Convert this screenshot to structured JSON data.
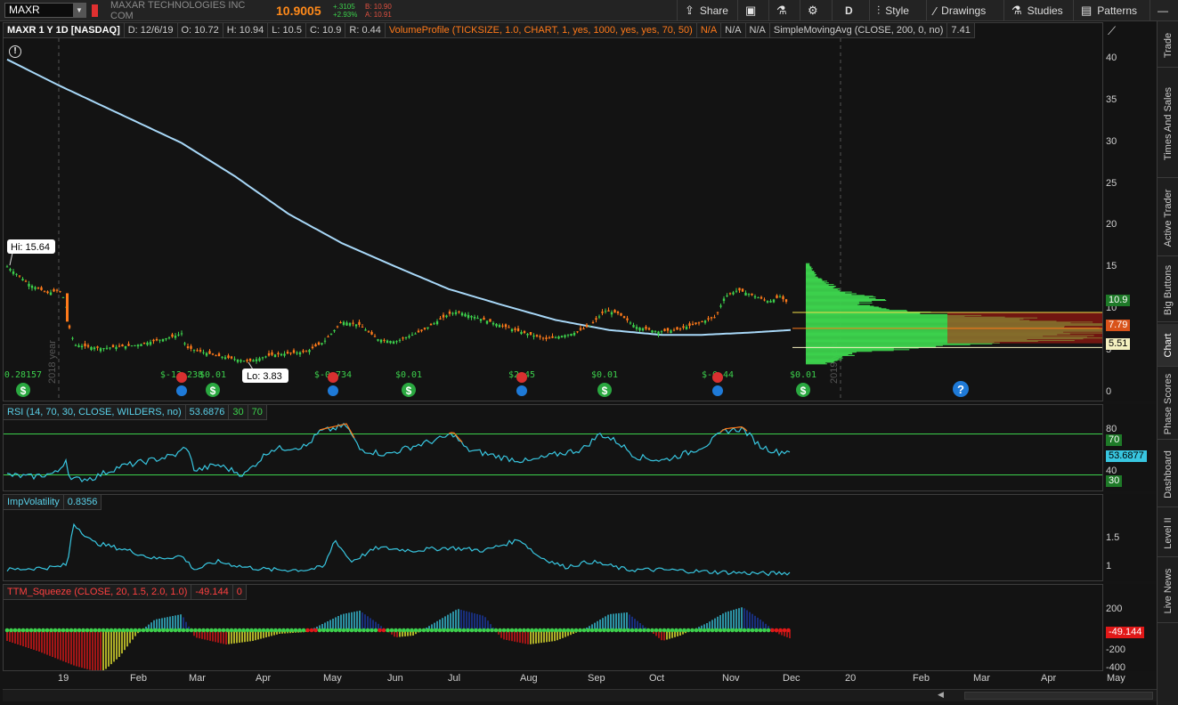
{
  "toolbar": {
    "symbol": "MAXR",
    "company": "MAXAR TECHNOLOGIES INC COM",
    "last": "10.9005",
    "change": "+.3105",
    "change_pct": "+2.93%",
    "bid": "B: 10.90",
    "ask": "A: 10.91",
    "buttons": {
      "share": "Share",
      "period": "D",
      "style": "Style",
      "drawings": "Drawings",
      "studies": "Studies",
      "patterns": "Patterns"
    }
  },
  "sidebar": {
    "tabs": [
      "Trade",
      "Times And Sales",
      "Active Trader",
      "Big Buttons",
      "Chart",
      "Phase Scores",
      "Dashboard",
      "Level II",
      "Live News"
    ],
    "active": "Chart"
  },
  "price_panel": {
    "header": [
      "MAXR 1 Y 1D [NASDAQ]",
      "D: 12/6/19",
      "O: 10.72",
      "H: 10.94",
      "L: 10.5",
      "C: 10.9",
      "R: 0.44",
      "VolumeProfile (TICKSIZE, 1.0, CHART, 1, yes, 1000, yes, yes, 70, 50)",
      "N/A",
      "N/A",
      "N/A",
      "SimpleMovingAvg (CLOSE, 200, 0, no)",
      "7.41"
    ],
    "hi_label": "Hi: 15.64",
    "lo_label": "Lo: 3.83",
    "year_2018": "2018 year",
    "year_2019": "2019 year",
    "axis_ticks": [
      "40",
      "35",
      "30",
      "25",
      "20",
      "15",
      "10",
      "5",
      "0"
    ],
    "price_bubbles": {
      "last": "10.9",
      "poc": "7.79",
      "low": "5.51"
    },
    "events": [
      {
        "type": "dividend",
        "value": "0.28157"
      },
      {
        "type": "earnings",
        "value": "$-12.238"
      },
      {
        "type": "dividend",
        "value": "$0.01"
      },
      {
        "type": "earnings",
        "value": "$-0.734"
      },
      {
        "type": "dividend",
        "value": "$0.01"
      },
      {
        "type": "earnings",
        "value": "$2.45"
      },
      {
        "type": "dividend",
        "value": "$0.01"
      },
      {
        "type": "earnings",
        "value": "$-0.44"
      },
      {
        "type": "dividend",
        "value": "$0.01"
      }
    ],
    "colors": {
      "up": "#3cd04c",
      "down": "#ff7a1a",
      "sma": "#a8d8f8",
      "profile": "#3cd04c",
      "value_area": "#c01a10"
    }
  },
  "rsi_panel": {
    "header": [
      "RSI (14, 70, 30, CLOSE, WILDERS, no)",
      "53.6876",
      "30",
      "70"
    ],
    "axis_ticks": [
      "80",
      "40"
    ],
    "bubbles": {
      "ob": "70",
      "value": "53.6877",
      "os": "30"
    }
  },
  "iv_panel": {
    "header": [
      "ImpVolatility",
      "0.8356"
    ],
    "axis_ticks": [
      "1.5",
      "1"
    ]
  },
  "ttm_panel": {
    "header": [
      "TTM_Squeeze (CLOSE, 20, 1.5, 2.0, 1.0)",
      "-49.144",
      "0"
    ],
    "axis_ticks": [
      "200",
      "-200",
      "-400"
    ],
    "bubble": "-49.144"
  },
  "time_axis": [
    "19",
    "Feb",
    "Mar",
    "Apr",
    "May",
    "Jun",
    "Jul",
    "Aug",
    "Sep",
    "Oct",
    "Nov",
    "Dec",
    "20",
    "Feb",
    "Mar",
    "Apr",
    "May"
  ]
}
